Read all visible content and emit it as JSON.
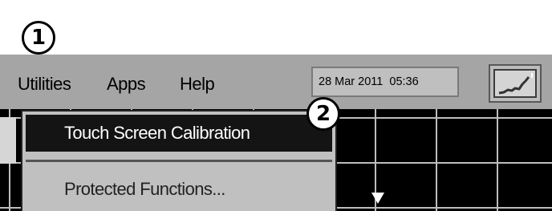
{
  "callouts": {
    "first": "1",
    "second": "2"
  },
  "menubar": {
    "items": [
      {
        "label": "Utilities"
      },
      {
        "label": "Apps"
      },
      {
        "label": "Help"
      }
    ],
    "datetime": "28 Mar 2011  05:36",
    "graph_button_icon": "trend-graph-icon"
  },
  "dropdown": {
    "items": [
      {
        "label": "Touch Screen Calibration",
        "highlighted": true
      },
      {
        "label": "Protected Functions..."
      }
    ]
  },
  "colors": {
    "menubar": "#a5a5a5",
    "display": "#000000",
    "highlight": "#141414",
    "dropdown": "#c0c0c0"
  }
}
